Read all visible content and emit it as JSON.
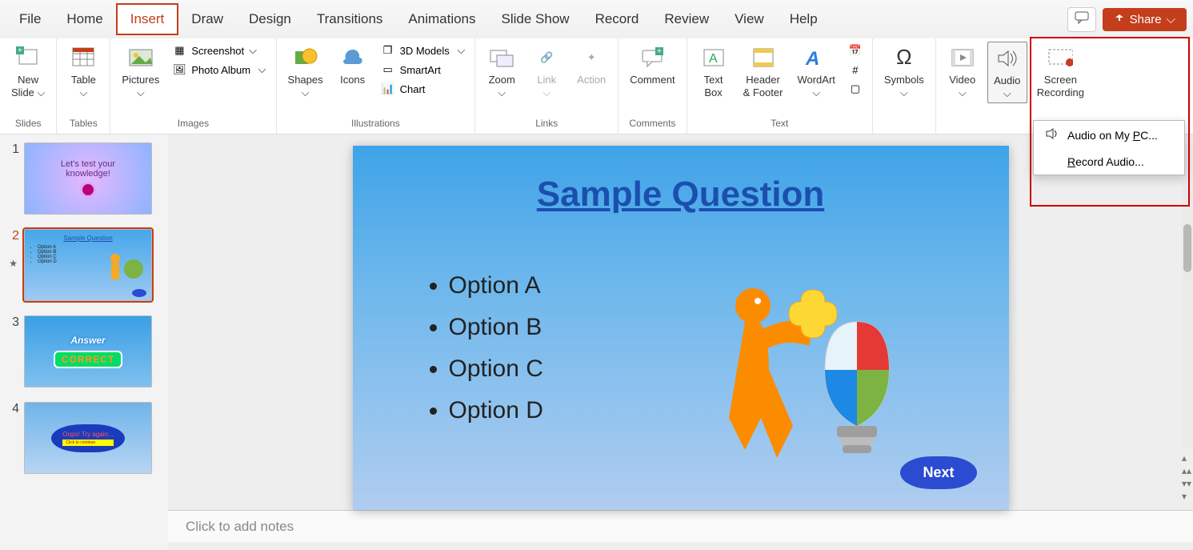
{
  "menu": {
    "file": "File",
    "home": "Home",
    "insert": "Insert",
    "draw": "Draw",
    "design": "Design",
    "transitions": "Transitions",
    "animations": "Animations",
    "slideshow": "Slide Show",
    "record": "Record",
    "review": "Review",
    "view": "View",
    "help": "Help",
    "share": "Share"
  },
  "ribbon": {
    "slides": {
      "new_slide": "New\nSlide",
      "group": "Slides"
    },
    "tables": {
      "table": "Table",
      "group": "Tables"
    },
    "images": {
      "pictures": "Pictures",
      "screenshot": "Screenshot",
      "photo_album": "Photo Album",
      "group": "Images"
    },
    "illustrations": {
      "shapes": "Shapes",
      "icons": "Icons",
      "models": "3D Models",
      "smartart": "SmartArt",
      "chart": "Chart",
      "group": "Illustrations"
    },
    "links": {
      "zoom": "Zoom",
      "link": "Link",
      "action": "Action",
      "group": "Links"
    },
    "comments": {
      "comment": "Comment",
      "group": "Comments"
    },
    "text": {
      "textbox": "Text\nBox",
      "header": "Header\n& Footer",
      "wordart": "WordArt",
      "group": "Text"
    },
    "symbols": {
      "symbols": "Symbols"
    },
    "media": {
      "video": "Video",
      "audio": "Audio",
      "screen_recording": "Screen\nRecording"
    }
  },
  "audio_menu": {
    "on_pc": "Audio on My PC...",
    "record": "Record Audio..."
  },
  "thumbs": {
    "1": {
      "line1": "Let's test your",
      "line2": "knowledge!"
    },
    "2": {
      "title": "Sample Question",
      "a": "Option A",
      "b": "Option B",
      "c": "Option C",
      "d": "Option D"
    },
    "3": {
      "answer": "Answer",
      "correct": "CORRECT"
    },
    "4": {
      "oops": "Oops! Try again...",
      "sub": "Click to continue"
    }
  },
  "slide": {
    "title": "Sample Question",
    "options": [
      "Option A",
      "Option B",
      "Option C",
      "Option D"
    ],
    "next": "Next"
  },
  "notes_placeholder": "Click to add notes"
}
